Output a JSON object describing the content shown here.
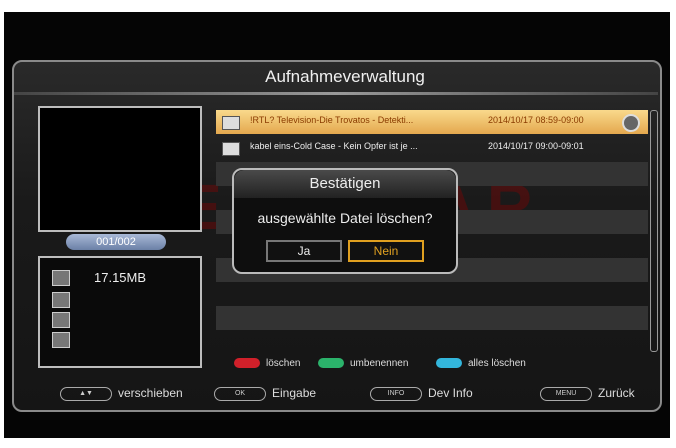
{
  "header": {
    "title": "Aufnahmeverwaltung"
  },
  "watermark": "TELESTAR",
  "left": {
    "counter": "001/002",
    "size": "17.15MB"
  },
  "recordings": [
    {
      "title": "!RTL? Television-Die Trovatos - Detekti...",
      "time": "2014/10/17 08:59-09:00"
    },
    {
      "title": "kabel eins-Cold Case - Kein Opfer ist je ...",
      "time": "2014/10/17 09:00-09:01"
    }
  ],
  "dialog": {
    "title": "Bestätigen",
    "message": "ausgewählte Datei löschen?",
    "yes": "Ja",
    "no": "Nein"
  },
  "legend": {
    "red": "löschen",
    "green": "umbenennen",
    "blue": "alles löschen"
  },
  "footer": {
    "move": {
      "key": "▲▼",
      "label": "verschieben"
    },
    "ok": {
      "key": "OK",
      "label": "Eingabe"
    },
    "info": {
      "key": "INFO",
      "label": "Dev Info"
    },
    "menu": {
      "key": "MENU",
      "label": "Zurück"
    }
  },
  "colors": {
    "highlight": "#e4a84e",
    "red": "#d0202a",
    "green": "#2bb36b",
    "blue": "#33b6dc",
    "selected_button": "#e0a020"
  }
}
